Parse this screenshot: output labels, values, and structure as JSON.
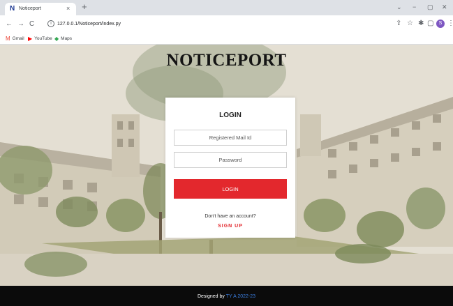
{
  "browser": {
    "tab_title": "Noticeport",
    "tab_favicon": "N",
    "tab_close": "×",
    "new_tab": "+",
    "window_controls": {
      "down": "⌄",
      "minimize": "−",
      "maximize": "▢",
      "close": "✕"
    },
    "nav": {
      "back": "←",
      "forward": "→",
      "reload": "C"
    },
    "url": "127.0.0.1/Noticeport/index.py",
    "toolbar_icons": {
      "share": "⇪",
      "star": "☆",
      "extensions": "✱",
      "side_panel": "▢"
    },
    "profile_initial": "S",
    "bookmarks": [
      {
        "icon": "gmail-icon",
        "glyph": "M",
        "label": "Gmail",
        "color": "#ea4335"
      },
      {
        "icon": "youtube-icon",
        "glyph": "▶",
        "label": "YouTube",
        "color": "#ff0000"
      },
      {
        "icon": "maps-icon",
        "glyph": "◆",
        "label": "Maps",
        "color": "#34a853"
      }
    ]
  },
  "page": {
    "title": "NOTICEPORT",
    "login": {
      "heading": "LOGIN",
      "email_placeholder": "Registered Mail Id",
      "password_placeholder": "Password",
      "button_label": "LOGIN",
      "no_account_text": "Don't have an account?",
      "signup_label": "SIGN UP"
    },
    "footer": {
      "prefix": "Designed by ",
      "credit": "TY A 2022-23"
    }
  },
  "colors": {
    "accent_red": "#e3282d",
    "footer_bg": "#0b0b0b",
    "footer_link": "#3b7ddd"
  }
}
